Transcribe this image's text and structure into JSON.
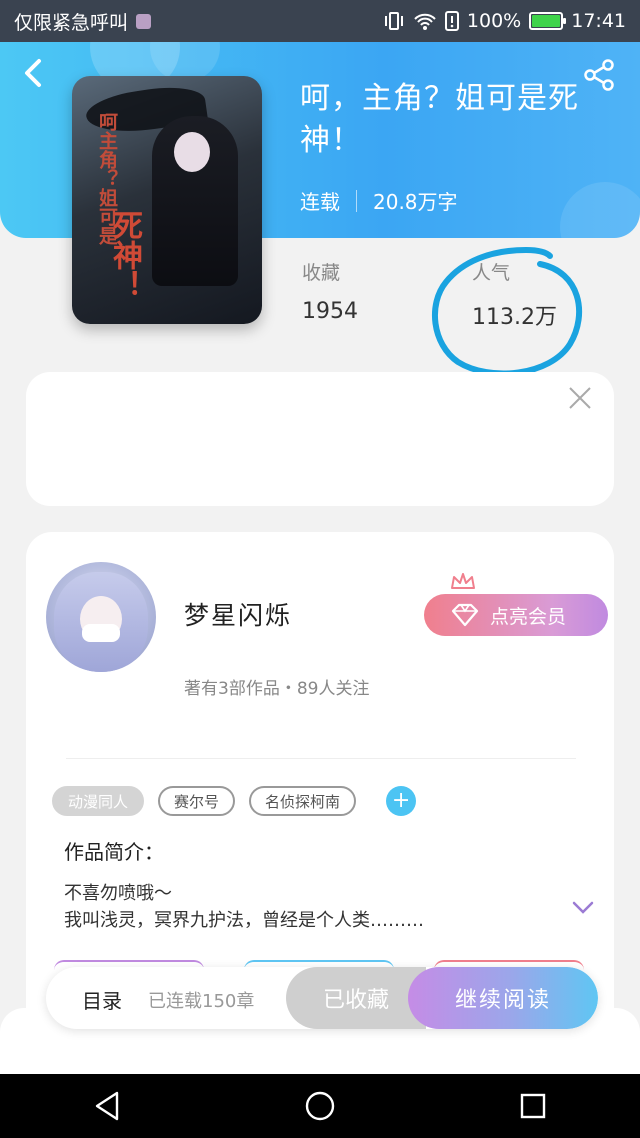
{
  "status_bar": {
    "carrier_text": "仅限紧急呼叫",
    "battery": "100%",
    "time": "17:41"
  },
  "header": {
    "back_icon": "chevron-left-icon",
    "share_icon": "share-icon",
    "book_title": "呵，主角？姐可是死神！",
    "status": "连载",
    "word_count": "20.8万字"
  },
  "cover": {
    "title_small": "呵主角？姐可是",
    "title_big": "死神！"
  },
  "stats": {
    "favorites_label": "收藏",
    "favorites_value": "1954",
    "popularity_label": "人气",
    "popularity_value": "113.2万"
  },
  "ad": {
    "close_icon": "close-icon"
  },
  "author_card": {
    "name": "梦星闪烁",
    "vip_button": "点亮会员",
    "works_info": "著有3部作品・89人关注",
    "tags": [
      "动漫同人",
      "赛尔号",
      "名侦探柯南"
    ],
    "tag_add": "+",
    "intro_heading": "作品简介：",
    "intro_line1": "不喜勿喷哦～",
    "intro_line2": "我叫浅灵，冥界九护法，曾经是个人类………"
  },
  "bottom_bar": {
    "toc_label": "目录",
    "toc_sub": "已连载150章",
    "favorited_button": "已收藏",
    "continue_button": "继续阅读"
  },
  "colors": {
    "header_blue": "#3ba6f3",
    "accent_purple": "#9b7bd4",
    "annotation_circle": "#1aa3e0"
  }
}
